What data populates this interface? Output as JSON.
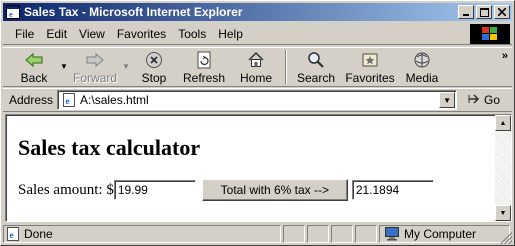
{
  "window": {
    "title": "Sales Tax - Microsoft Internet Explorer",
    "minimize_icon": "minimize-icon",
    "maximize_icon": "maximize-icon",
    "close_icon": "close-icon"
  },
  "menu": {
    "items": [
      "File",
      "Edit",
      "View",
      "Favorites",
      "Tools",
      "Help"
    ]
  },
  "toolbar": {
    "back": "Back",
    "forward": "Forward",
    "stop": "Stop",
    "refresh": "Refresh",
    "home": "Home",
    "search": "Search",
    "favorites": "Favorites",
    "media": "Media",
    "more": "»"
  },
  "address": {
    "label": "Address",
    "url": "A:\\sales.html",
    "go": "Go"
  },
  "page": {
    "heading": "Sales tax calculator",
    "amount_label": "Sales amount: $",
    "amount_value": "19.99",
    "button_label": "Total with 6% tax -->",
    "result_value": "21.1894"
  },
  "status": {
    "text": "Done",
    "zone": "My Computer"
  },
  "colors": {
    "titlebar_start": "#0a246a",
    "titlebar_end": "#a6caf0",
    "chrome": "#d4d0c8"
  }
}
